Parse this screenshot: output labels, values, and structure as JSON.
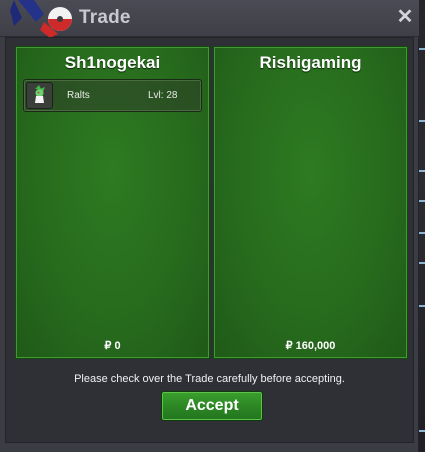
{
  "window": {
    "title": "Trade",
    "close_symbol": "✕"
  },
  "trade": {
    "left": {
      "player": "Sh1nogekai",
      "items": [
        {
          "pokemon": "Ralts",
          "level": "Lvl: 28",
          "icon": "ralts-icon"
        }
      ],
      "money": "₽ 0"
    },
    "right": {
      "player": "Rishigaming",
      "items": [],
      "money": "₽ 160,000"
    }
  },
  "notice": "Please check over the Trade carefully before accepting.",
  "accept_label": "Accept",
  "colors": {
    "panel_green": "#276b1d",
    "accept_green": "#2b8523",
    "window_bg": "#3c3c44"
  }
}
